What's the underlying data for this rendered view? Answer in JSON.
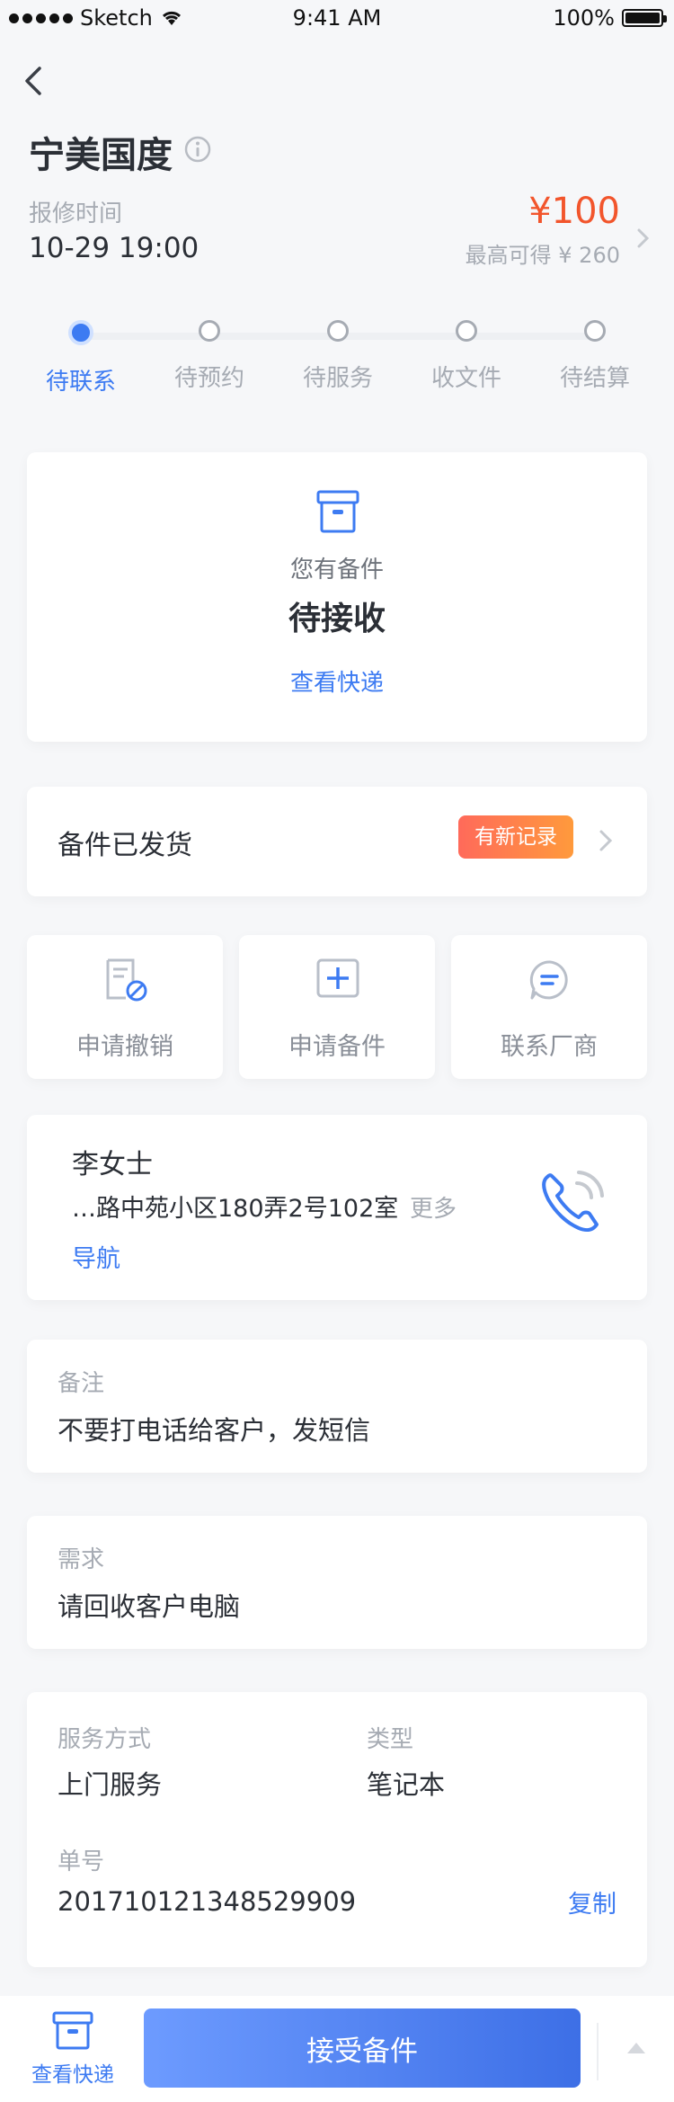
{
  "status_bar": {
    "carrier": "Sketch",
    "time": "9:41 AM",
    "battery": "100%"
  },
  "header": {
    "title": "宁美国度",
    "repair_time_label": "报修时间",
    "repair_time": "10-29 19:00",
    "price": "¥100",
    "max_price": "最高可得 ¥ 260"
  },
  "steps": [
    {
      "label": "待联系",
      "active": true
    },
    {
      "label": "待预约",
      "active": false
    },
    {
      "label": "待服务",
      "active": false
    },
    {
      "label": "收文件",
      "active": false
    },
    {
      "label": "待结算",
      "active": false
    }
  ],
  "receive_card": {
    "line1": "您有备件",
    "line2": "待接收",
    "link": "查看快递"
  },
  "shipment": {
    "label": "备件已发货",
    "badge": "有新记录"
  },
  "actions": [
    {
      "label": "申请撤销",
      "icon": "cancel-doc-icon"
    },
    {
      "label": "申请备件",
      "icon": "add-box-icon"
    },
    {
      "label": "联系厂商",
      "icon": "chat-icon"
    }
  ],
  "contact": {
    "name": "李女士",
    "address": "…路中苑小区180弄2号102室",
    "more": "更多",
    "navigate": "导航"
  },
  "note": {
    "label": "备注",
    "value": "不要打电话给客户，发短信"
  },
  "need": {
    "label": "需求",
    "value": "请回收客户电脑"
  },
  "details": {
    "service_label": "服务方式",
    "service_value": "上门服务",
    "type_label": "类型",
    "type_value": "笔记本",
    "order_label": "单号",
    "order_value": "201710121348529909",
    "copy": "复制"
  },
  "bottom_bar": {
    "express_label": "查看快递",
    "accept_label": "接受备件"
  },
  "colors": {
    "accent": "#3d7bf2",
    "price": "#f2552c",
    "badge_start": "#ff6a5a",
    "badge_end": "#ff9a3c"
  }
}
